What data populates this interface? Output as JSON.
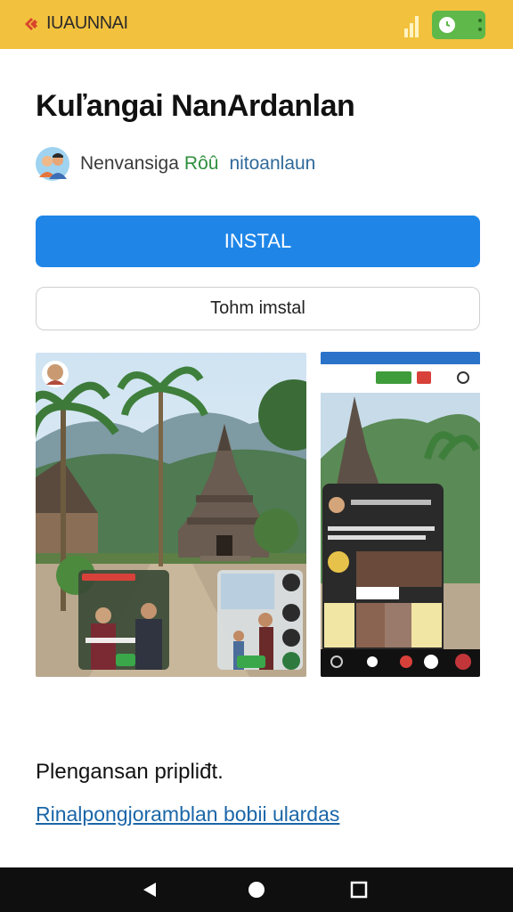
{
  "status_bar": {
    "brand_name": "IUAUNNAI",
    "colors": {
      "background": "#f2c23e",
      "battery": "#5fb84a"
    },
    "icons": [
      "brand-logo-icon",
      "signal-icon",
      "battery-toggle-icon"
    ]
  },
  "app": {
    "title": "Kuľangai NanArdanlan",
    "developer": "Nenvansiga",
    "developer_tag": "Rôû",
    "developer_meta": "nitoanlaun"
  },
  "buttons": {
    "install_label": "INSTAL",
    "secondary_label": "Tohm imstal",
    "colors": {
      "install": "#1f86e8"
    }
  },
  "screenshots": {
    "items": [
      {
        "name": "temple-village-screenshot",
        "overlay_labels": [
          "",
          ""
        ]
      },
      {
        "name": "temple-feed-screenshot"
      }
    ]
  },
  "details": {
    "title": "Plengansan pripliđt.",
    "link": "Rinalpongjoramblan bobii ulardas"
  },
  "nav_bar": {
    "icons": [
      "back-triangle-icon",
      "home-circle-icon",
      "recents-square-icon"
    ]
  }
}
